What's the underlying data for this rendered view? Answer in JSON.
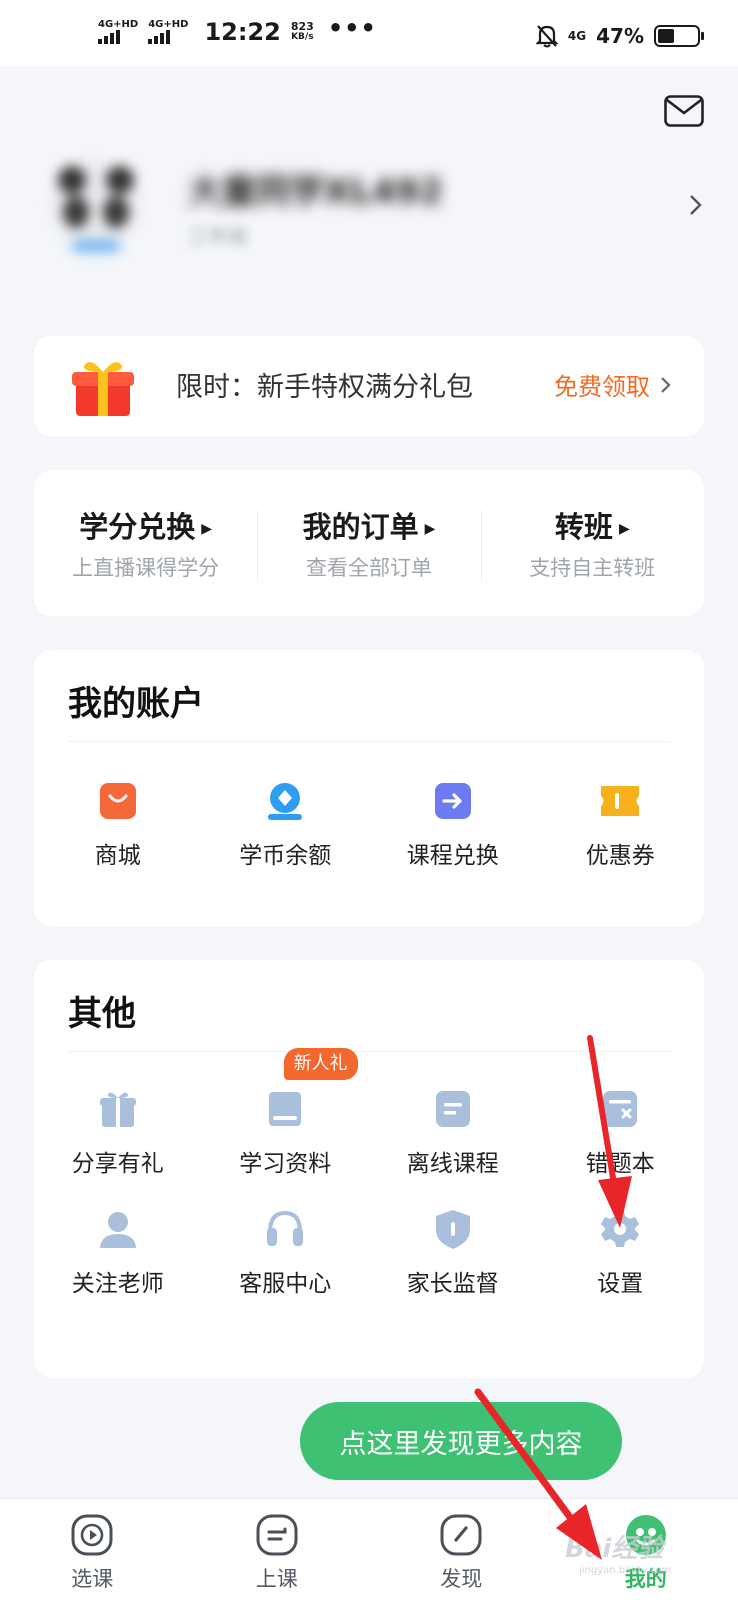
{
  "status_bar": {
    "sim1": "4G+HD",
    "sim2": "4G+HD",
    "time": "12:22",
    "speed_value": "823",
    "speed_unit": "KB/s",
    "more": "•••",
    "network": "4G",
    "battery_percent": "47%",
    "battery_level": 0.47
  },
  "profile": {
    "name": "大童同学XL492",
    "grade": "三年级"
  },
  "promo": {
    "text": "限时：新手特权满分礼包",
    "cta": "免费领取"
  },
  "quick_links": [
    {
      "title": "学分兑换",
      "subtitle": "上直播课得学分"
    },
    {
      "title": "我的订单",
      "subtitle": "查看全部订单"
    },
    {
      "title": "转班",
      "subtitle": "支持自主转班"
    }
  ],
  "account": {
    "title": "我的账户",
    "items": [
      {
        "label": "商城",
        "icon": "shopping-bag-icon",
        "color": "#f4683a"
      },
      {
        "label": "学币余额",
        "icon": "coin-icon",
        "color": "#2e9ef2"
      },
      {
        "label": "课程兑换",
        "icon": "exchange-arrow-icon",
        "color": "#6c7cf0"
      },
      {
        "label": "优惠券",
        "icon": "ticket-icon",
        "color": "#f7b21b"
      }
    ]
  },
  "others": {
    "title": "其他",
    "badge": "新人礼",
    "items": [
      {
        "label": "分享有礼",
        "icon": "gift-icon"
      },
      {
        "label": "学习资料",
        "icon": "book-icon"
      },
      {
        "label": "离线课程",
        "icon": "document-icon"
      },
      {
        "label": "错题本",
        "icon": "wrong-notebook-icon"
      },
      {
        "label": "关注老师",
        "icon": "person-icon"
      },
      {
        "label": "客服中心",
        "icon": "headset-icon"
      },
      {
        "label": "家长监督",
        "icon": "shield-icon"
      },
      {
        "label": "设置",
        "icon": "gear-icon"
      }
    ],
    "icon_color": "#a9bfdc"
  },
  "tooltip": "点这里发现更多内容",
  "bottom_nav": [
    {
      "label": "选课",
      "icon": "play-circle-icon"
    },
    {
      "label": "上课",
      "icon": "class-icon"
    },
    {
      "label": "发现",
      "icon": "compass-icon"
    },
    {
      "label": "我的",
      "icon": "profile-icon",
      "active": true
    }
  ],
  "watermark": {
    "main": "Bai经验",
    "sub": "jingyan.baidu.com"
  },
  "colors": {
    "accent_green": "#3ec173",
    "promo_orange": "#f26b22",
    "annotation_red": "#e8262a"
  }
}
